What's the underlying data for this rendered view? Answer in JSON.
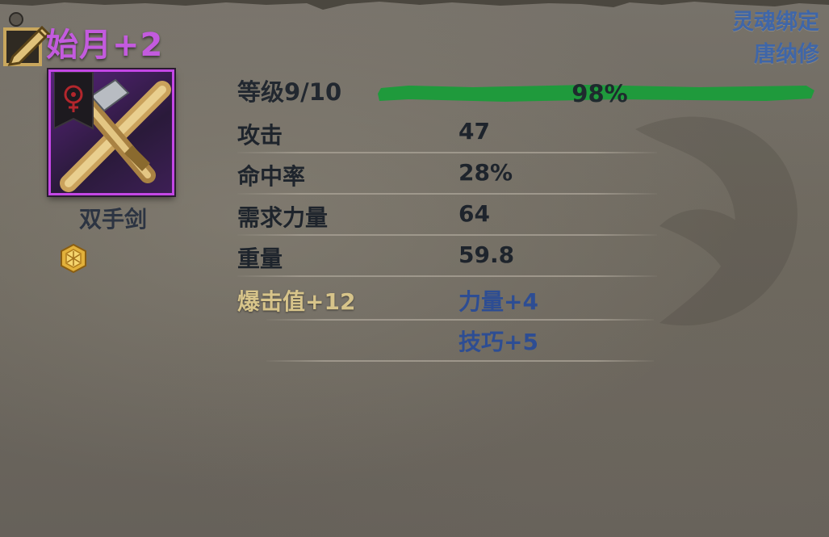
{
  "item": {
    "name": "始月+2",
    "type": "双手剑",
    "icon": "crossed-two-handed-swords-icon",
    "rarity_color": "#c447e6"
  },
  "binding": {
    "line1": "灵魂绑定",
    "line2": "唐纳修"
  },
  "level": {
    "label": "等级9/10",
    "progress_text": "98%",
    "progress": 0.98,
    "bar_color": "#1f9a3c"
  },
  "stats": [
    {
      "label": "攻击",
      "value": "47"
    },
    {
      "label": "命中率",
      "value": "28%"
    },
    {
      "label": "需求力量",
      "value": "64"
    },
    {
      "label": "重量",
      "value": "59.8"
    }
  ],
  "bonuses": {
    "crit": "爆击值+12",
    "strength": "力量+4",
    "skill": "技巧+5"
  },
  "icons": {
    "pen": "edit-pen-icon",
    "gem": "hexagon-gem-icon",
    "banner": "faction-banner-icon"
  }
}
